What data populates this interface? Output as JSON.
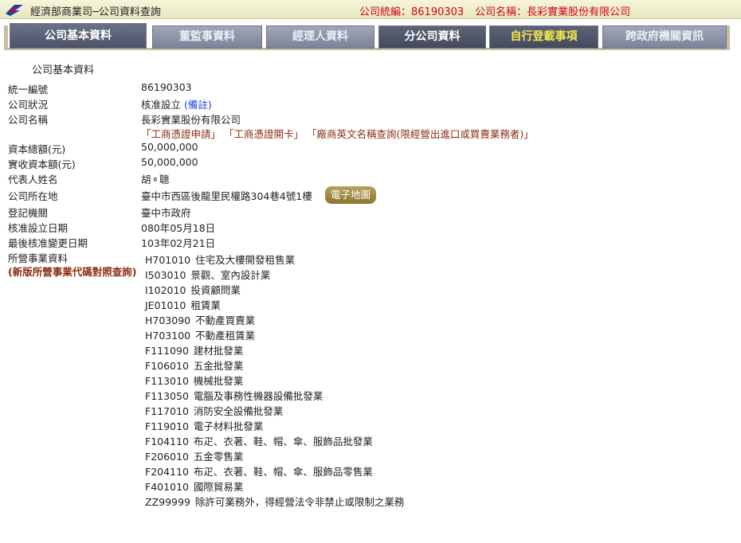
{
  "header": {
    "site_title": "經濟部商業司─公司資料查詢",
    "company_id_text": "公司統編：86190303",
    "company_name_text": "公司名稱：長彩實業股份有限公司",
    "logo_icon": "moea-logo-icon"
  },
  "tabs": [
    {
      "label": "公司基本資料",
      "state": "active"
    },
    {
      "label": "董監事資料",
      "state": "normal"
    },
    {
      "label": "經理人資料",
      "state": "normal"
    },
    {
      "label": "分公司資料",
      "state": "dark"
    },
    {
      "label": "自行登載事項",
      "state": "yellow"
    },
    {
      "label": "跨政府機關資訊",
      "state": "normal"
    }
  ],
  "section_title": "公司基本資料",
  "fields": {
    "uniform_no": {
      "label": "統一編號",
      "value": "86190303"
    },
    "status": {
      "label": "公司狀況",
      "value": "核准設立",
      "note_link": "(備註)"
    },
    "name": {
      "label": "公司名稱",
      "value": "長彩實業股份有限公司"
    },
    "capital_total": {
      "label": "資本總額(元)",
      "value": "50,000,000"
    },
    "capital_paid": {
      "label": "實收資本額(元)",
      "value": "50,000,000"
    },
    "representative": {
      "label": "代表人姓名",
      "value": "胡⚬聰"
    },
    "address": {
      "label": "公司所在地",
      "value": "臺中市西區後龍里民權路304巷4號1樓"
    },
    "authority": {
      "label": "登記機關",
      "value": "臺中市政府"
    },
    "approved_date": {
      "label": "核准設立日期",
      "value": "080年05月18日"
    },
    "last_change_date": {
      "label": "最後核准變更日期",
      "value": "103年02月21日"
    },
    "business": {
      "label": "所營事業資料"
    }
  },
  "name_links": [
    "「工商憑證申請」",
    "「工商憑證開卡」",
    "「廠商英文名稱查詢(限經營出進口或買賣業務者)」"
  ],
  "map_button": "電子地圖",
  "code_lookup_link": "(新版所營事業代碼對照查詢)",
  "business_items": [
    {
      "code": "H701010",
      "name": "住宅及大樓開發租售業"
    },
    {
      "code": "I503010",
      "name": "景觀、室內設計業"
    },
    {
      "code": "I102010",
      "name": "投資顧問業"
    },
    {
      "code": "JE01010",
      "name": "租賃業"
    },
    {
      "code": "H703090",
      "name": "不動產買賣業"
    },
    {
      "code": "H703100",
      "name": "不動產租賃業"
    },
    {
      "code": "F111090",
      "name": "建材批發業"
    },
    {
      "code": "F106010",
      "name": "五金批發業"
    },
    {
      "code": "F113010",
      "name": "機械批發業"
    },
    {
      "code": "F113050",
      "name": "電腦及事務性機器設備批發業"
    },
    {
      "code": "F117010",
      "name": "消防安全設備批發業"
    },
    {
      "code": "F119010",
      "name": "電子材料批發業"
    },
    {
      "code": "F104110",
      "name": "布疋、衣著、鞋、帽、傘、服飾品批發業"
    },
    {
      "code": "F206010",
      "name": "五金零售業"
    },
    {
      "code": "F204110",
      "name": "布疋、衣著、鞋、帽、傘、服飾品零售業"
    },
    {
      "code": "F401010",
      "name": "國際貿易業"
    },
    {
      "code": "ZZ99999",
      "name": "除許可業務外，得經營法令非禁止或限制之業務"
    }
  ]
}
